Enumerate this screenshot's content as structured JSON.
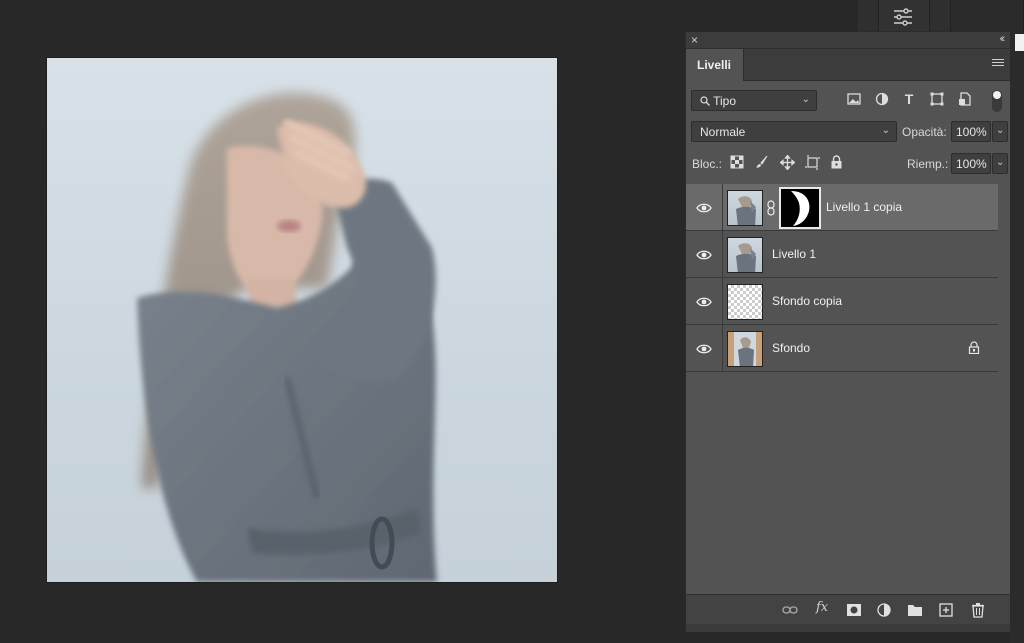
{
  "panel": {
    "close_glyph": "×",
    "collapse_glyph": "‹‹",
    "tab_label": "Livelli"
  },
  "filter": {
    "kind_label": "Tipo",
    "icons": [
      "image-filter-icon",
      "adjustment-filter-icon",
      "type-filter-icon",
      "shape-filter-icon",
      "smart-object-filter-icon"
    ],
    "type_glyph": "T"
  },
  "blend": {
    "mode": "Normale",
    "opacity_label": "Opacità:",
    "opacity_value": "100%"
  },
  "lock": {
    "label": "Bloc.:",
    "fill_label": "Riemp.:",
    "fill_value": "100%"
  },
  "layers": [
    {
      "name": "Livello 1 copia",
      "visible": true,
      "selected": true,
      "has_mask": true,
      "thumb": "photo"
    },
    {
      "name": "Livello 1",
      "visible": true,
      "selected": false,
      "has_mask": false,
      "thumb": "photo"
    },
    {
      "name": "Sfondo copia",
      "visible": true,
      "selected": false,
      "has_mask": false,
      "thumb": "transparent"
    },
    {
      "name": "Sfondo",
      "visible": true,
      "selected": false,
      "has_mask": false,
      "thumb": "photo-background",
      "locked": true
    }
  ],
  "bottom_bar": {
    "fx_label": "fx",
    "icons": [
      "link-layers-icon",
      "fx-icon",
      "add-mask-icon",
      "adjustment-layer-icon",
      "group-folder-icon",
      "new-layer-icon",
      "delete-layer-icon"
    ]
  },
  "colors": {
    "workspace": "#282828",
    "panel": "#535353",
    "selected_layer": "#6a6a6a",
    "canvas_bg": "#d3dce3",
    "coat": "#6b747e"
  }
}
